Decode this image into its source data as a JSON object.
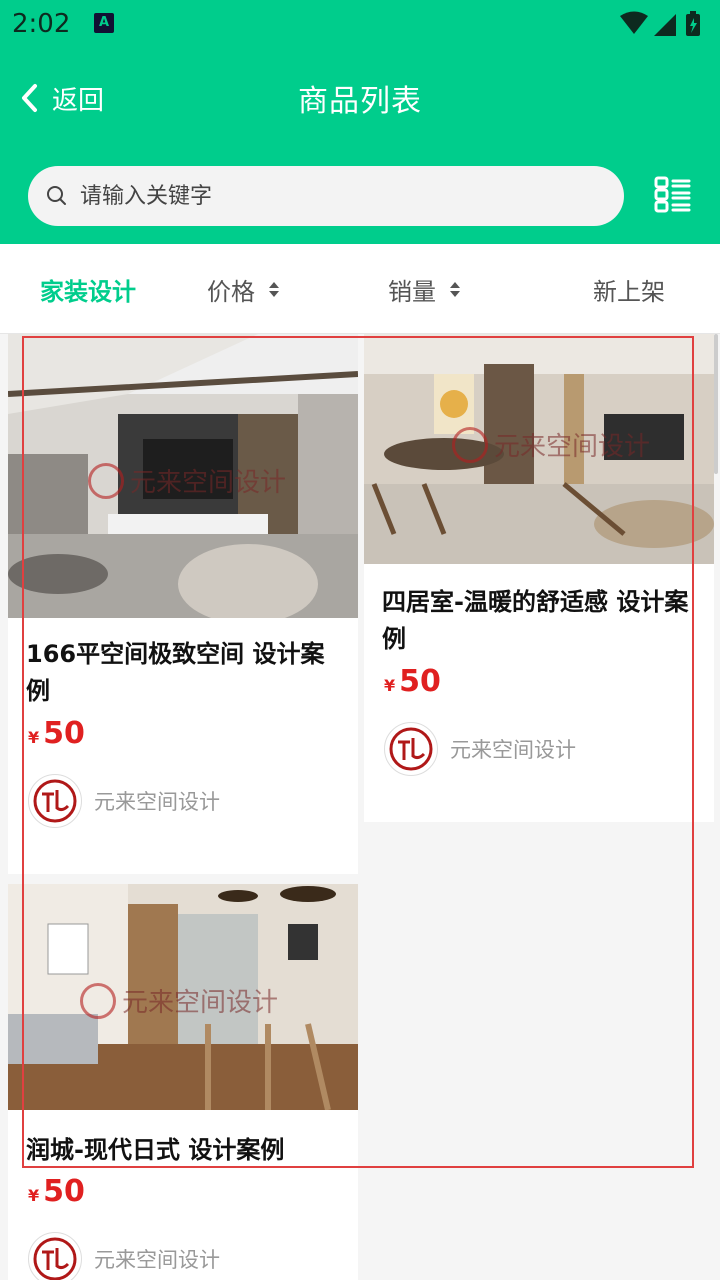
{
  "status_bar": {
    "time": "2:02",
    "notification_badge": "A"
  },
  "nav": {
    "back_label": "返回",
    "title": "商品列表"
  },
  "search": {
    "placeholder": "请输入关键字"
  },
  "filters": [
    {
      "label": "家装设计",
      "active": true,
      "sortable": false
    },
    {
      "label": "价格",
      "active": false,
      "sortable": true
    },
    {
      "label": "销量",
      "active": false,
      "sortable": true
    },
    {
      "label": "新上架",
      "active": false,
      "sortable": false
    }
  ],
  "products": [
    {
      "title": "166平空间极致空间 设计案例",
      "currency": "¥",
      "price": "50",
      "shop": "元来空间设计",
      "watermark": "元来空间设计"
    },
    {
      "title": "四居室-温暖的舒适感 设计案例",
      "currency": "¥",
      "price": "50",
      "shop": "元来空间设计",
      "watermark": "元来空间设计"
    },
    {
      "title": "润城-现代日式 设计案例",
      "currency": "¥",
      "price": "50",
      "shop": "元来空间设计",
      "watermark": "元来空间设计"
    }
  ],
  "colors": {
    "brand": "#00cd8c",
    "price": "#e02020",
    "selection": "#e04040"
  }
}
